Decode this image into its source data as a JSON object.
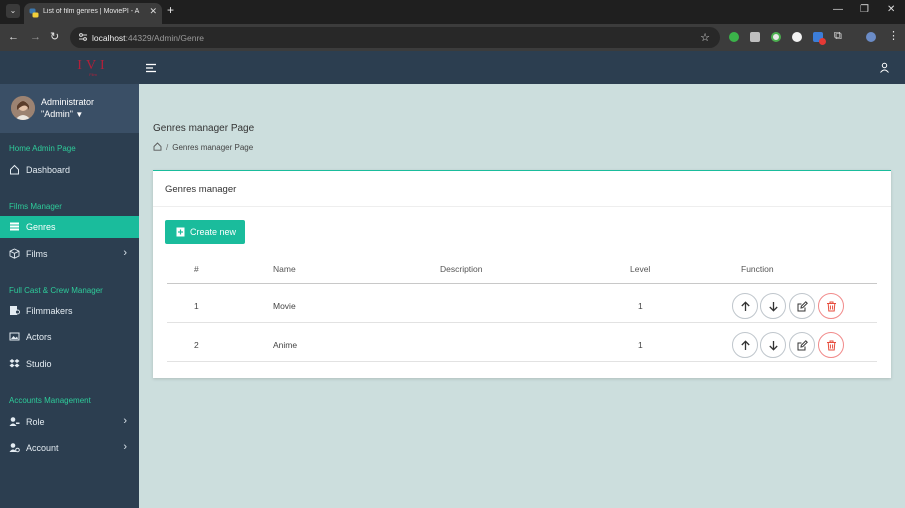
{
  "browser": {
    "tab_title": "List of film genres | MoviePI - A",
    "url_host": "localhost",
    "url_path": ":44329/Admin/Genre",
    "new_tab": "+",
    "minimize": "—",
    "restore": "❐",
    "close": "✕"
  },
  "app": {
    "logo_text": "IVI",
    "logo_sub": "Film"
  },
  "sidebar": {
    "user_role": "Administrator",
    "user_name": "\"Admin\"",
    "sections": [
      {
        "title": "Home Admin Page"
      },
      {
        "title": "Films Manager"
      },
      {
        "title": "Full Cast & Crew Manager"
      },
      {
        "title": "Accounts Management"
      }
    ],
    "items": [
      {
        "label": "Dashboard",
        "icon": "home-icon"
      },
      {
        "label": "Genres",
        "icon": "list-icon",
        "active": true
      },
      {
        "label": "Films",
        "icon": "cube-icon",
        "has_arrow": true
      },
      {
        "label": "Filmmakers",
        "icon": "filmmakers-icon"
      },
      {
        "label": "Actors",
        "icon": "image-icon"
      },
      {
        "label": "Studio",
        "icon": "studio-icon"
      },
      {
        "label": "Role",
        "icon": "user-key-icon",
        "has_arrow": true
      },
      {
        "label": "Account",
        "icon": "user-cog-icon",
        "has_arrow": true
      }
    ]
  },
  "page": {
    "title": "Genres manager Page",
    "breadcrumb_sep": "/",
    "breadcrumb_current": "Genres manager Page"
  },
  "card": {
    "title": "Genres manager",
    "create_label": "Create new"
  },
  "table": {
    "headers": [
      "#",
      "Name",
      "Description",
      "Level",
      "Function"
    ],
    "rows": [
      {
        "num": "1",
        "name": "Movie",
        "description": "",
        "level": "1"
      },
      {
        "num": "2",
        "name": "Anime",
        "description": "",
        "level": "1"
      }
    ]
  },
  "colors": {
    "accent": "#1abc9c",
    "sidebar_bg": "#2c3e50",
    "content_bg": "#ccdedd",
    "delete": "#e74c3c"
  }
}
